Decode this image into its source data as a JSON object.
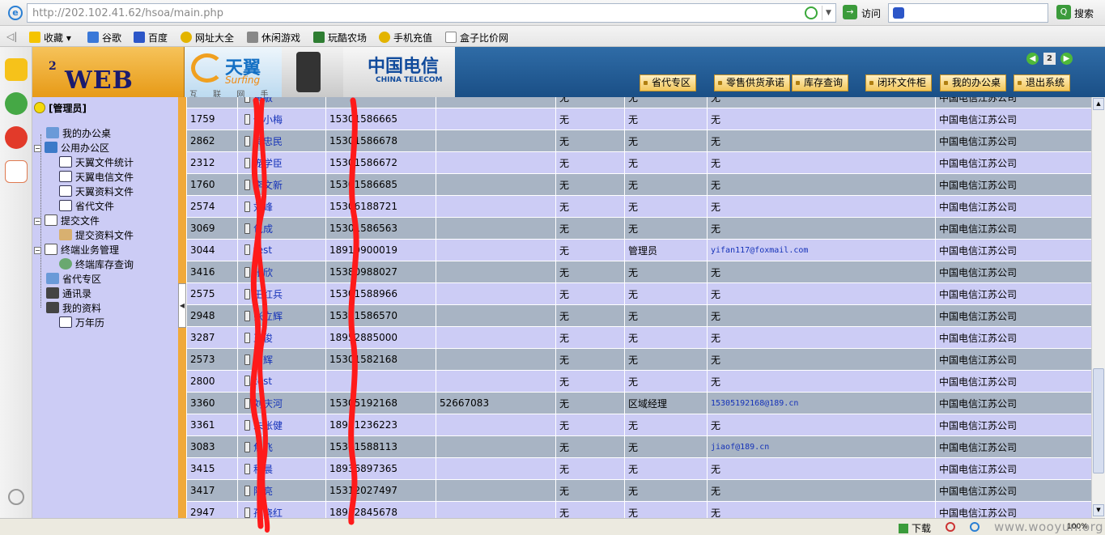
{
  "browser": {
    "url": "http://202.102.41.62/hsoa/main.php",
    "visit_label": "访问",
    "search_label": "搜索",
    "favorites": [
      "收藏",
      "谷歌",
      "百度",
      "网址大全",
      "休闲游戏",
      "玩酷农场",
      "手机充值",
      "盒子比价网"
    ],
    "status": {
      "download_label": "下载",
      "zoom": "100%",
      "watermark": "www.wooyun.org"
    }
  },
  "header": {
    "logo": "WEB OA",
    "logo_sup": "2",
    "brand_cn": "天翼",
    "brand_en": "Surfing",
    "brand_slogan": "互 联 网 手 机",
    "telecom_cn": "中国电信",
    "telecom_en": "CHINA TELECOM",
    "nav": [
      "省代专区",
      "零售供货承诺",
      "库存查询",
      "闭环文件柜",
      "我的办公桌",
      "退出系统"
    ]
  },
  "sidebar": {
    "admin": "[管理员]",
    "tree": [
      "我的办公桌",
      "公用办公区",
      "天翼文件统计",
      "天翼电信文件",
      "天翼资料文件",
      "省代文件",
      "提交文件",
      "提交资料文件",
      "终端业务管理",
      "终端库存查询",
      "省代专区",
      "通讯录",
      "我的资料",
      "万年历"
    ]
  },
  "table": {
    "rows": [
      [
        "",
        "黄敏",
        "",
        "",
        "无",
        "无",
        "无",
        "中国电信江苏公司"
      ],
      [
        "1759",
        "倪小梅",
        "15301586665",
        "",
        "无",
        "无",
        "无",
        "中国电信江苏公司"
      ],
      [
        "2862",
        "黄忠民",
        "15301586678",
        "",
        "无",
        "无",
        "无",
        "中国电信江苏公司"
      ],
      [
        "2312",
        "庞学臣",
        "15301586672",
        "",
        "无",
        "无",
        "无",
        "中国电信江苏公司"
      ],
      [
        "1760",
        "李文新",
        "15301586685",
        "",
        "无",
        "无",
        "无",
        "中国电信江苏公司"
      ],
      [
        "2574",
        "刘峰",
        "15306188721",
        "",
        "无",
        "无",
        "无",
        "中国电信江苏公司"
      ],
      [
        "3069",
        "包成",
        "15301586563",
        "",
        "无",
        "无",
        "无",
        "中国电信江苏公司"
      ],
      [
        "3044",
        "test",
        "18919900019",
        "",
        "无",
        "管理员",
        "yifan117@foxmail.com",
        "中国电信江苏公司"
      ],
      [
        "3416",
        "张欣",
        "15380988027",
        "",
        "无",
        "无",
        "无",
        "中国电信江苏公司"
      ],
      [
        "2575",
        "王红兵",
        "15301588966",
        "",
        "无",
        "无",
        "无",
        "中国电信江苏公司"
      ],
      [
        "2948",
        "张立辉",
        "15301586570",
        "",
        "无",
        "无",
        "无",
        "中国电信江苏公司"
      ],
      [
        "3287",
        "王俊",
        "18952885000",
        "",
        "无",
        "无",
        "无",
        "中国电信江苏公司"
      ],
      [
        "2573",
        "周辉",
        "15301582168",
        "",
        "无",
        "无",
        "无",
        "中国电信江苏公司"
      ],
      [
        "2800",
        "test",
        "",
        "",
        "无",
        "无",
        "无",
        "中国电信江苏公司"
      ],
      [
        "3360",
        "刘庆河",
        "15305192168",
        "52667083",
        "无",
        "区域经理",
        "15305192168@189.cn",
        "中国电信江苏公司"
      ],
      [
        "3361",
        "朱张健",
        "18951236223",
        "",
        "无",
        "无",
        "无",
        "中国电信江苏公司"
      ],
      [
        "3083",
        "焦飞",
        "15301588113",
        "",
        "无",
        "无",
        "jiaof@189.cn",
        "中国电信江苏公司"
      ],
      [
        "3415",
        "程晨",
        "18936897365",
        "",
        "无",
        "无",
        "无",
        "中国电信江苏公司"
      ],
      [
        "3417",
        "陈亮",
        "15312027497",
        "",
        "无",
        "无",
        "无",
        "中国电信江苏公司"
      ],
      [
        "2947",
        "孙晓红",
        "18912845678",
        "",
        "无",
        "无",
        "无",
        "中国电信江苏公司"
      ]
    ]
  },
  "colors": {
    "row_light": "#ccccf5",
    "row_dark": "#a8b4c4",
    "sidebar": "#ccccf5",
    "accent_orange": "#f0a93a",
    "header_blue": "#1a4f86",
    "redaction": "#ff1a1a"
  }
}
